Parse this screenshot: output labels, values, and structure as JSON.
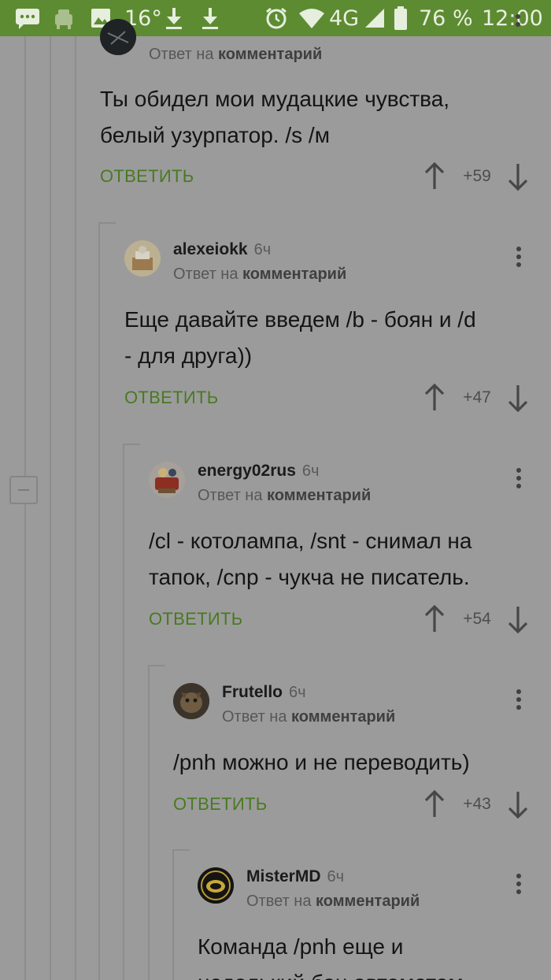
{
  "status_bar": {
    "temperature": "16°",
    "network": "4G",
    "battery": "76 %",
    "time": "12:00"
  },
  "comments": [
    {
      "author": "",
      "time": "",
      "reply_prefix": "Ответ на",
      "reply_target": "комментарий",
      "text_lines": [
        "Ты обидел мои мудацкие чувства,",
        "белый узурпатор. /s /м"
      ],
      "reply_label": "ОТВЕТИТЬ",
      "rating": "+59"
    },
    {
      "author": "alexeiokk",
      "time": "6ч",
      "reply_prefix": "Ответ на",
      "reply_target": "комментарий",
      "text_lines": [
        "Еще давайте введем /b - боян и /d",
        "- для друга))"
      ],
      "reply_label": "ОТВЕТИТЬ",
      "rating": "+47"
    },
    {
      "author": "energy02rus",
      "time": "6ч",
      "reply_prefix": "Ответ на",
      "reply_target": "комментарий",
      "text_lines": [
        "/cl - котолампа, /snt - снимал на",
        "тапок, /cnp - чукча не писатель."
      ],
      "reply_label": "ОТВЕТИТЬ",
      "rating": "+54"
    },
    {
      "author": "Frutello",
      "time": "6ч",
      "reply_prefix": "Ответ на",
      "reply_target": "комментарий",
      "text_lines": [
        "/pnh можно и не переводить)"
      ],
      "reply_label": "ОТВЕТИТЬ",
      "rating": "+43"
    },
    {
      "author": "MisterMD",
      "time": "6ч",
      "reply_prefix": "Ответ на",
      "reply_target": "комментарий",
      "text_lines": [
        "Команда /pnh еще и",
        "недолький бан автоматом"
      ],
      "reply_label": "",
      "rating": ""
    }
  ]
}
